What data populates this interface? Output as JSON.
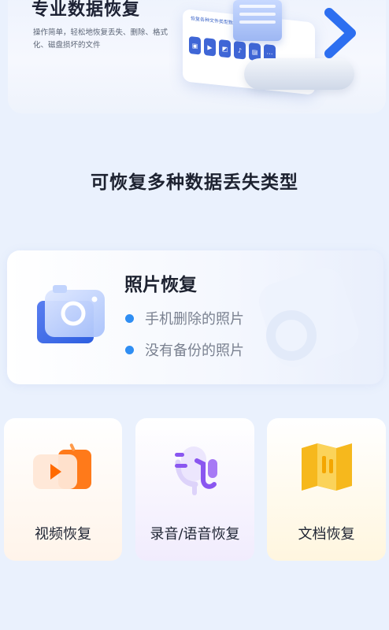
{
  "banner": {
    "title": "专业数据恢复",
    "description": "操作简单，轻松地恢复丢失、删除、格式化、磁盘损坏的文件",
    "mock_label": "恢复各种文件类型数据"
  },
  "section_title": "可恢复多种数据丢失类型",
  "photo_card": {
    "title": "照片恢复",
    "bullets": [
      "手机删除的照片",
      "没有备份的照片"
    ]
  },
  "cards": [
    {
      "label": "视频恢复",
      "icon": "video-icon",
      "color": "#ff7a1a"
    },
    {
      "label": "录音/语音恢复",
      "icon": "microphone-icon",
      "color": "#8a56f0"
    },
    {
      "label": "文档恢复",
      "icon": "document-icon",
      "color": "#f6b81d"
    }
  ],
  "colors": {
    "accent_blue": "#2f8ef3",
    "background": "#eaf1fd"
  }
}
